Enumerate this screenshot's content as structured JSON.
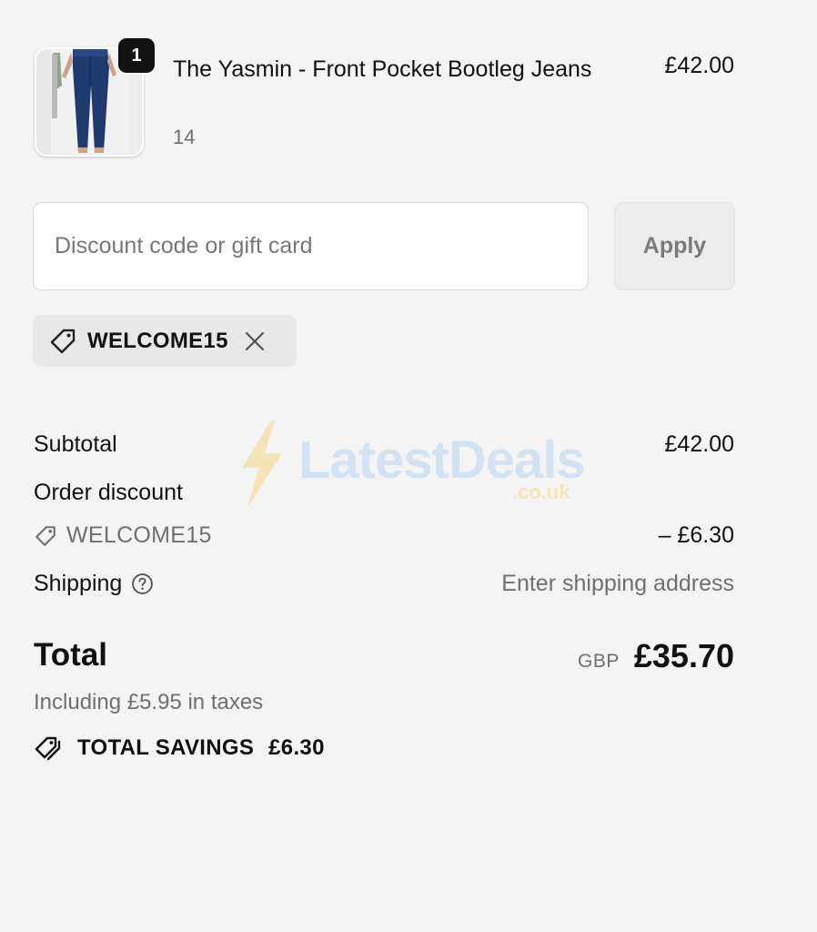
{
  "cart": {
    "items": [
      {
        "title": "The Yasmin - Front Pocket Bootleg Jeans",
        "variant": "14",
        "price": "£42.00",
        "quantity": "1",
        "image_icon": "jeans-product-image"
      }
    ]
  },
  "discount": {
    "placeholder": "Discount code or gift card",
    "apply_label": "Apply",
    "applied_code": "WELCOME15"
  },
  "summary": {
    "subtotal_label": "Subtotal",
    "subtotal_value": "£42.00",
    "order_discount_label": "Order discount",
    "discount_code": "WELCOME15",
    "discount_value": "– £6.30",
    "shipping_label": "Shipping",
    "shipping_value": "Enter shipping address",
    "total_label": "Total",
    "currency": "GBP",
    "total_value": "£35.70",
    "tax_note": "Including £5.95 in taxes",
    "savings_label": "TOTAL SAVINGS",
    "savings_value": "£6.30"
  },
  "watermark": {
    "brand": "LatestDeals",
    "domain": ".co.uk"
  },
  "colors": {
    "background": "#f4f4f4",
    "text": "#111111",
    "muted": "#6f6f6f",
    "chip": "#e8e8e8"
  }
}
